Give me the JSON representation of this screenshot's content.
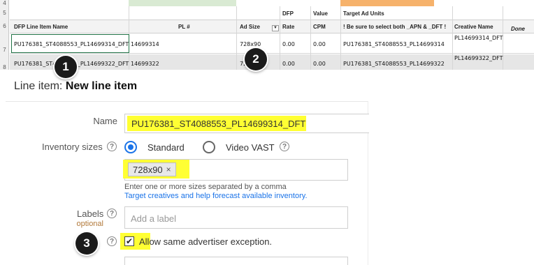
{
  "spreadsheet": {
    "row_numbers": [
      "4",
      "5",
      "6",
      "7",
      "8"
    ],
    "headers": {
      "line_item_name": "DFP Line Item Name",
      "pl_num": "PL #",
      "ad_size": "Ad Size",
      "dfp": "DFP",
      "rate": "Rate",
      "value": "Value",
      "cpm": "CPM",
      "target_ad_units": "Target Ad Units",
      "target_note": "! Be sure to select both _APN & _DFT !",
      "creative_name": "Creative Name",
      "done": "Done"
    },
    "filter_icon": "dropdown-arrow",
    "rows": [
      {
        "line_item_name": "PU176381_ST4088553_PL14699314_DFT",
        "pl_num": "14699314",
        "ad_size": "728x90",
        "rate": "0.00",
        "cpm": "0.00",
        "target_ad_units": "PU176381_ST4088553_PL14699314",
        "creative_name": "PL14699314_DFT"
      },
      {
        "line_item_name": "PU176381_ST4088553_PL14699322_DFT",
        "pl_num": "14699322",
        "ad_size": "728x90",
        "rate": "0.00",
        "cpm": "0.00",
        "target_ad_units": "PU176381_ST4088553_PL14699322",
        "creative_name": "PL14699322_DFT"
      }
    ]
  },
  "badges": [
    "1",
    "2",
    "3"
  ],
  "form": {
    "title_prefix": "Line item: ",
    "title_value": "New line item",
    "name_label": "Name",
    "name_value": "PU176381_ST4088553_PL14699314_DFT",
    "inventory_label": "Inventory sizes",
    "radio_standard": "Standard",
    "radio_video": "Video VAST",
    "size_chip": "728x90",
    "chip_remove": "×",
    "sizes_hint": "Enter one or more sizes separated by a comma",
    "sizes_link": "Target creatives and help forecast available inventory.",
    "labels_label": "Labels",
    "labels_optional": "optional",
    "labels_placeholder": "Add a label",
    "checkbox_label": "Allow same advertiser exception.",
    "checkbox_mark": "✔",
    "help_glyph": "?"
  },
  "colors": {
    "highlight": "#ffff33",
    "accent": "#1a73e8",
    "badge": "#1b1b1b"
  }
}
